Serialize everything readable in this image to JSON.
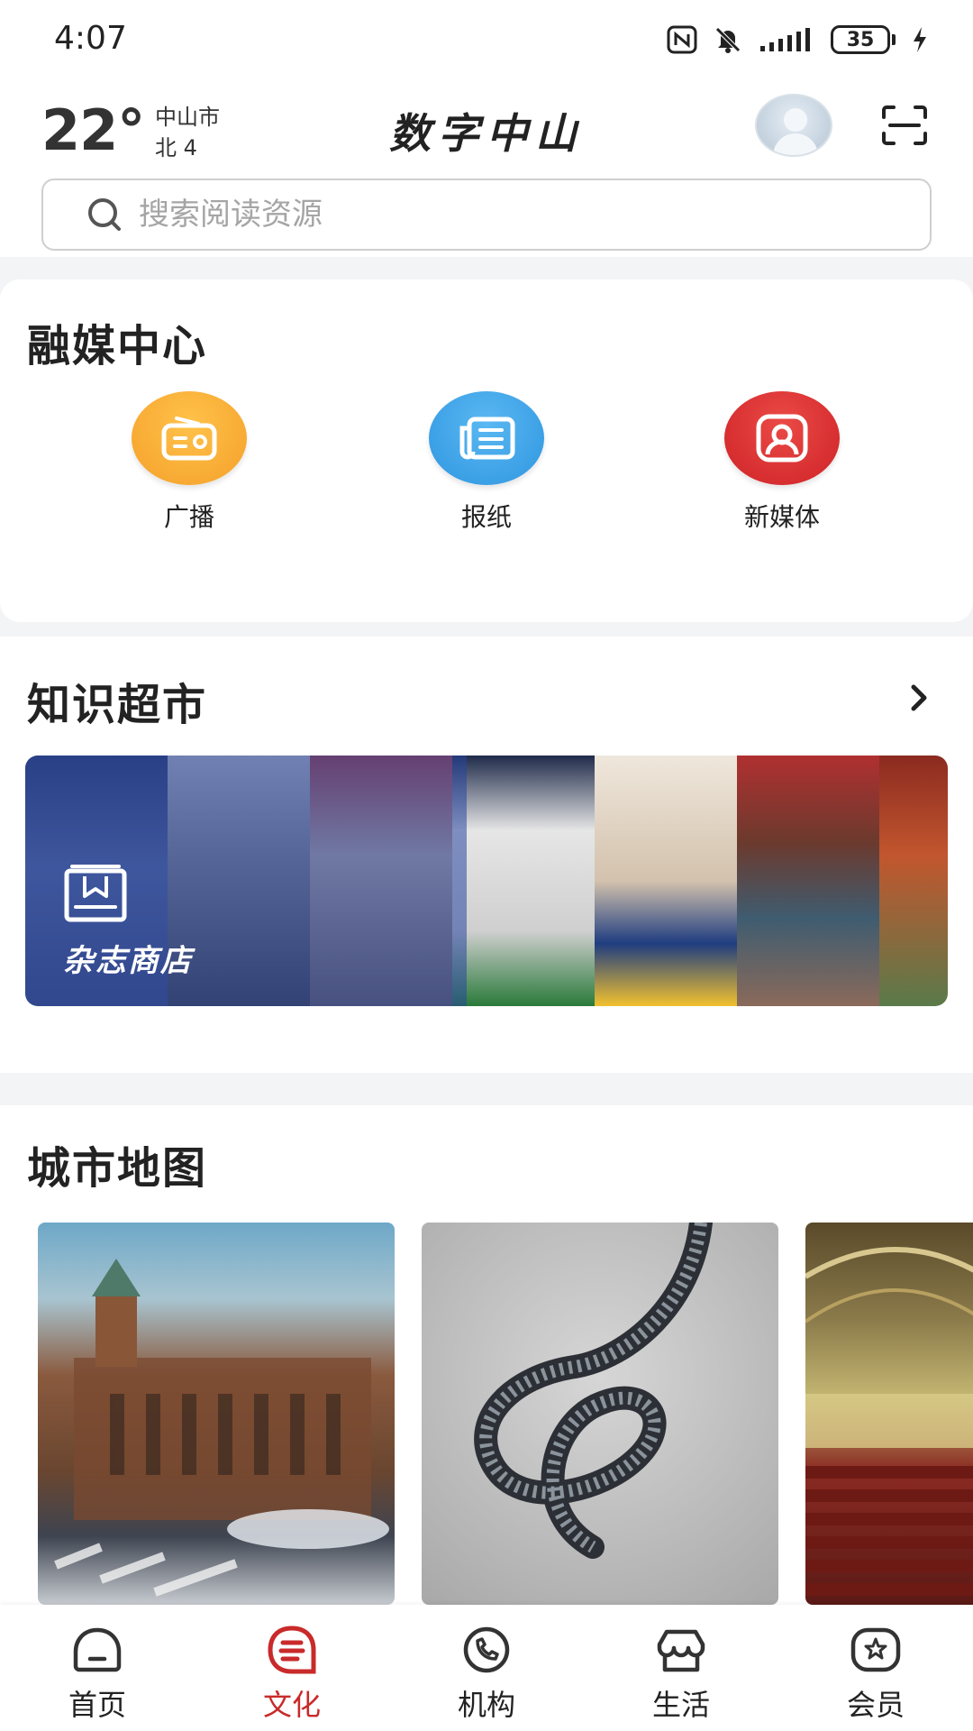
{
  "status_bar": {
    "time": "4:07",
    "battery": "35",
    "icons": [
      "nfc-icon",
      "bell-muted-icon",
      "signal-icon",
      "battery-icon",
      "charging-icon"
    ]
  },
  "header": {
    "temperature": "22°",
    "city": "中山市",
    "wind": "北 4",
    "title": "数字中山",
    "avatar_icon": "user-avatar",
    "scan_icon": "scan-icon"
  },
  "search": {
    "placeholder": "搜索阅读资源"
  },
  "media_center": {
    "title": "融媒中心",
    "items": [
      {
        "label": "广播",
        "icon": "radio-icon",
        "color": "#f6a623"
      },
      {
        "label": "报纸",
        "icon": "newspaper-icon",
        "color": "#2f9ee6"
      },
      {
        "label": "新媒体",
        "icon": "new-media-icon",
        "color": "#d8282d"
      }
    ]
  },
  "knowledge_market": {
    "title": "知识超市",
    "more_icon": "chevron-right-icon",
    "banner": {
      "label": "杂志商店",
      "icon": "magazine-shop-icon"
    }
  },
  "city_map": {
    "title": "城市地图",
    "cards": [
      {
        "icon": "historic-building-photo"
      },
      {
        "icon": "film-reel-photo"
      },
      {
        "icon": "theater-photo"
      }
    ]
  },
  "bottom_nav": {
    "accent": "#c92a2a",
    "items": [
      {
        "label": "首页",
        "icon": "home-icon",
        "active": false
      },
      {
        "label": "文化",
        "icon": "culture-icon",
        "active": true
      },
      {
        "label": "机构",
        "icon": "institution-icon",
        "active": false
      },
      {
        "label": "生活",
        "icon": "life-icon",
        "active": false
      },
      {
        "label": "会员",
        "icon": "member-icon",
        "active": false
      }
    ]
  }
}
